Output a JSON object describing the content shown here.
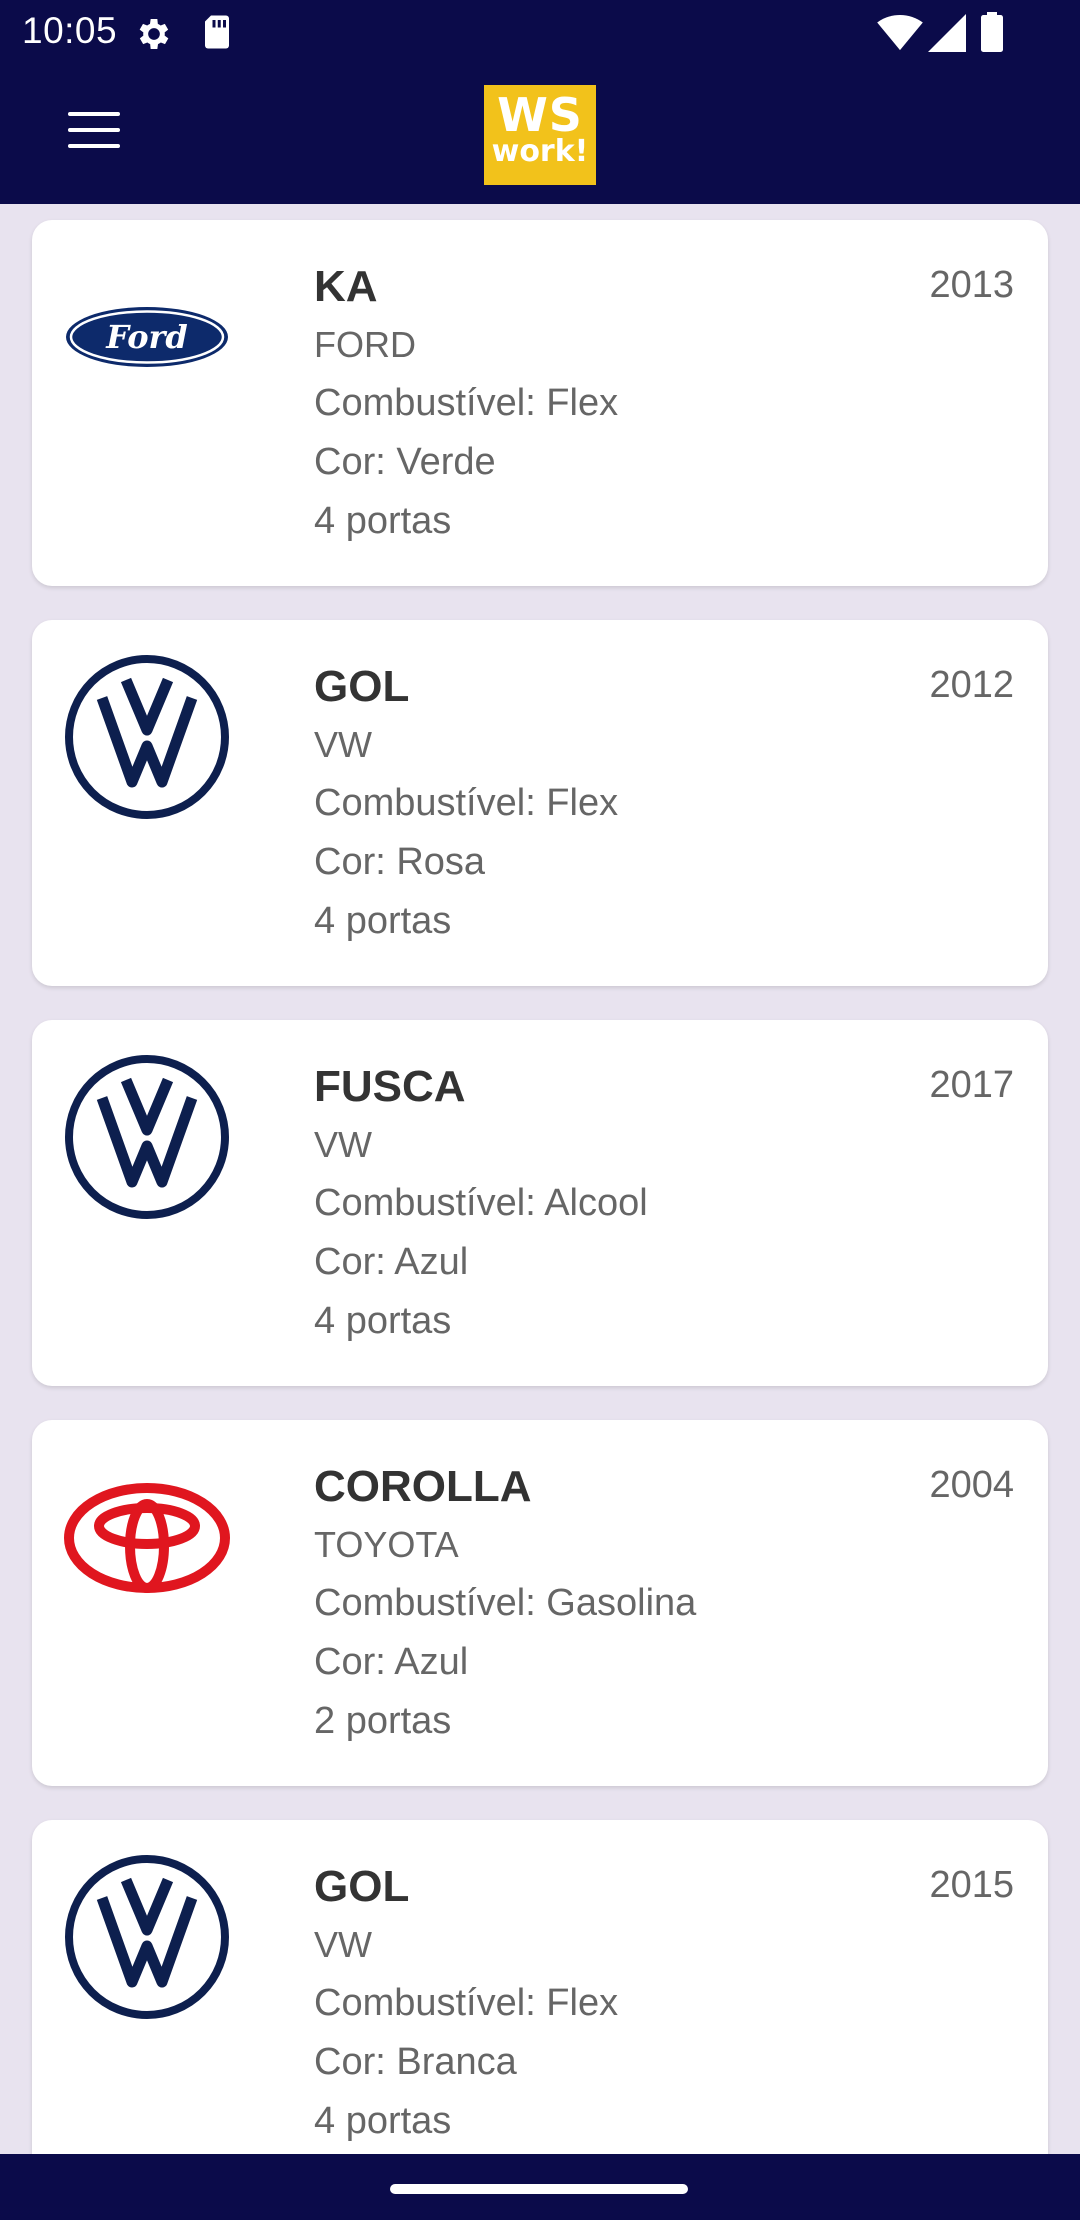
{
  "status_bar": {
    "time": "10:05",
    "icons": [
      "gear-icon",
      "sd-card-icon",
      "wifi-icon",
      "signal-icon",
      "battery-icon"
    ]
  },
  "app_bar": {
    "menu_icon": "hamburger-menu-icon",
    "logo_line1": "WS",
    "logo_line2": "work!",
    "logo_bg": "#f2c21b",
    "bg": "#0b0b4a"
  },
  "vehicles": [
    {
      "model": "KA",
      "brand": "FORD",
      "fuel": "Combustível: Flex",
      "color": "Cor: Verde",
      "doors": "4 portas",
      "year": "2013",
      "logo": "ford-logo"
    },
    {
      "model": "GOL",
      "brand": "VW",
      "fuel": "Combustível: Flex",
      "color": "Cor: Rosa",
      "doors": "4 portas",
      "year": "2012",
      "logo": "vw-logo"
    },
    {
      "model": "FUSCA",
      "brand": "VW",
      "fuel": "Combustível: Alcool",
      "color": "Cor: Azul",
      "doors": "4 portas",
      "year": "2017",
      "logo": "vw-logo"
    },
    {
      "model": "COROLLA",
      "brand": "TOYOTA",
      "fuel": "Combustível: Gasolina",
      "color": "Cor: Azul",
      "doors": "2 portas",
      "year": "2004",
      "logo": "toyota-logo"
    },
    {
      "model": "GOL",
      "brand": "VW",
      "fuel": "Combustível: Flex",
      "color": "Cor: Branca",
      "doors": "4 portas",
      "year": "2015",
      "logo": "vw-logo"
    }
  ]
}
